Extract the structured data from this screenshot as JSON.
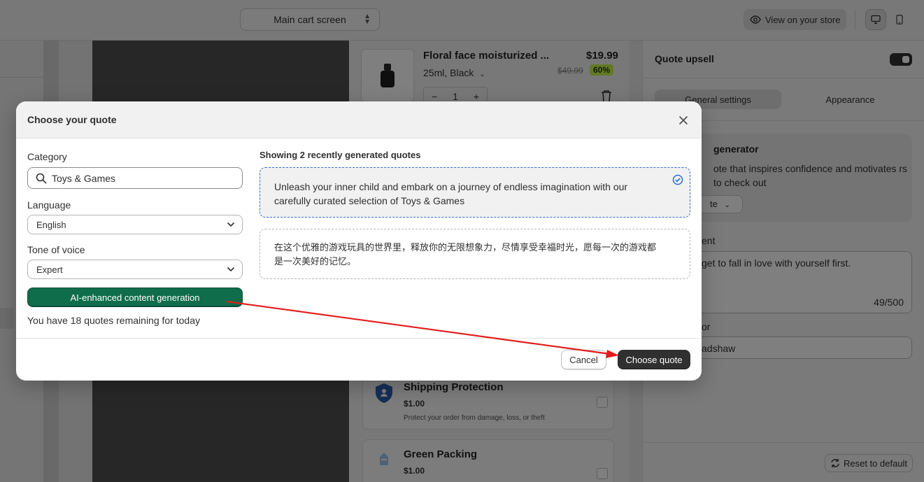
{
  "topbar": {
    "screen_select": "Main cart screen",
    "view_store": "View on your store"
  },
  "product": {
    "name": "Floral face moisturized ...",
    "variant": "25ml, Black",
    "price": "$19.99",
    "compare_price": "$49.99",
    "discount_badge": "60%",
    "quantity": "1",
    "qty_minus": "−",
    "qty_plus": "+"
  },
  "upsells": [
    {
      "title": "Shipping Protection",
      "price": "$1.00",
      "description": "Protect your order from damage, loss, or theft"
    },
    {
      "title": "Green Packing",
      "price": "$1.00"
    }
  ],
  "settings": {
    "title": "Quote upsell",
    "tabs": [
      "General settings",
      "Appearance"
    ],
    "generator_title": "generator",
    "generator_desc": "ote that inspires confidence and motivates rs to check out",
    "generator_btn": "te",
    "content_label": "ent",
    "content_text": "get to fall in love with yourself first.",
    "content_count": "49/500",
    "author_label": "or",
    "author_value": "adshaw",
    "reset_label": "Reset to default"
  },
  "modal": {
    "title": "Choose your quote",
    "category_label": "Category",
    "category_value": "Toys & Games",
    "language_label": "Language",
    "language_value": "English",
    "tone_label": "Tone of voice",
    "tone_value": "Expert",
    "ai_button": "AI-enhanced content generation",
    "remaining": "You have 18 quotes remaining for today",
    "showing": "Showing 2 recently generated quotes",
    "quotes": [
      {
        "text": "Unleash your inner child and embark on a journey of endless imagination with our carefully curated selection of Toys & Games",
        "selected": true
      },
      {
        "text": "在这个优雅的游戏玩具的世界里，释放你的无限想象力，尽情享受幸福时光，愿每一次的游戏都是一次美好的记忆。",
        "selected": false
      }
    ],
    "cancel": "Cancel",
    "choose": "Choose quote"
  },
  "colors": {
    "ai_button": "#0f6d4c",
    "primary_button": "#303030",
    "selected_border": "#2c6ecb",
    "annotation_arrow": "#e31b1b",
    "badge": "#c8f24a"
  }
}
